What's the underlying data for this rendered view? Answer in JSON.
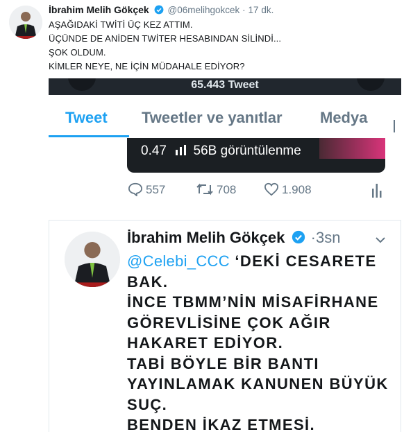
{
  "outer_tweet": {
    "name": "İbrahim Melih Gökçek",
    "handle": "@06melihgokcek",
    "separator": "·",
    "time": "17 dk.",
    "lines": [
      "AŞAĞIDAKİ TWİTİ ÜÇ KEZ ATTIM.",
      "ÜÇÜNDE DE ANİDEN TWİTER HESABINDAN SİLİNDİ...",
      "ŞOK OLDUM.",
      "KİMLER NEYE, NE İÇİN MÜDAHALE EDİYOR?"
    ]
  },
  "screenshot": {
    "tweet_count": "65.443 Tweet",
    "tabs": [
      {
        "label": "Tweet",
        "active": true
      },
      {
        "label": "Tweetler ve yanıtlar",
        "active": false
      },
      {
        "label": "Medya",
        "active": false
      }
    ],
    "video": {
      "time": "0.47",
      "views": "56B görüntülenme"
    },
    "actions": {
      "replies": "557",
      "retweets": "708",
      "likes": "1.908"
    },
    "inner_tweet": {
      "name": "İbrahim Melih Gökçek",
      "separator": "·",
      "time": "3sn",
      "mention": "@Celebi_CCC",
      "first_line_rest": " ‘DEKİ CESARETE",
      "lines": [
        "BAK.",
        "İNCE TBMM’NİN MİSAFİRHANE",
        "GÖREVLİSİNE ÇOK AĞIR",
        "HAKARET EDİYOR.",
        "TABİ BÖYLE BİR BANTI",
        "YAYINLAMAK KANUNEN BÜYÜK",
        "SUÇ.",
        "BENDEN İKAZ ETMESİ."
      ]
    }
  },
  "colors": {
    "accent": "#1da1f2",
    "muted": "#657786",
    "text": "#14171a"
  }
}
